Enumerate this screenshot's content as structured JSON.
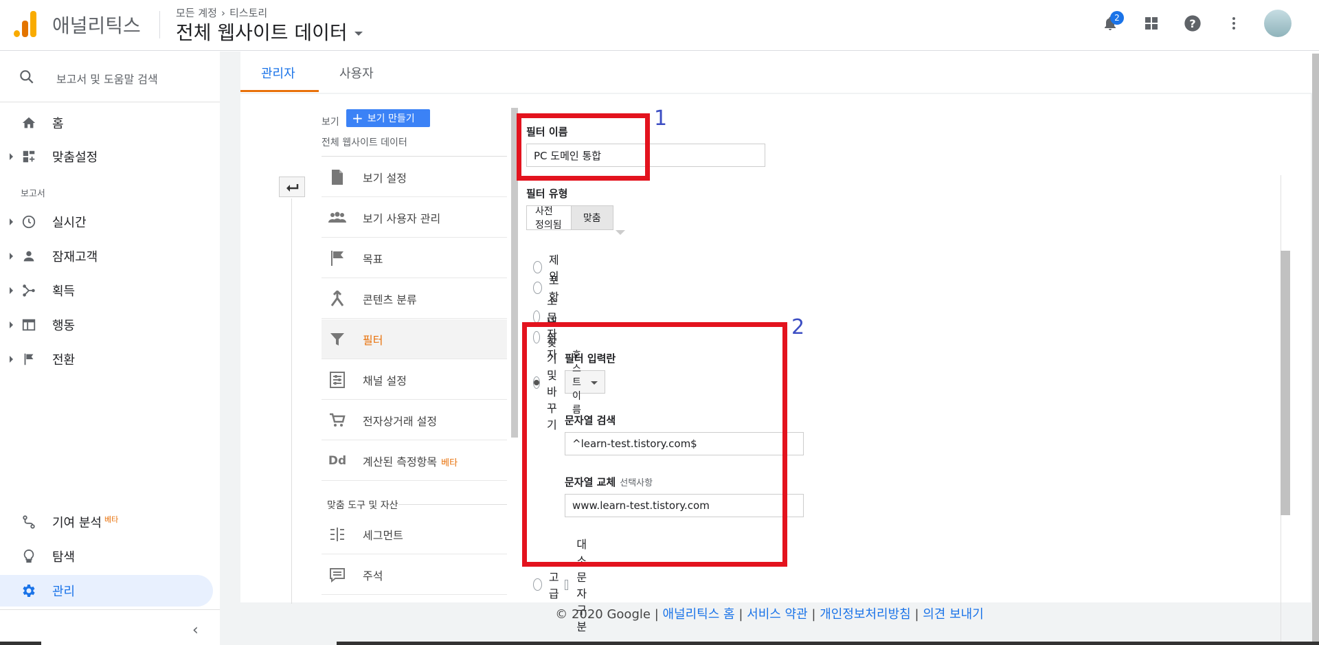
{
  "header": {
    "brand": "애널리틱스",
    "crumb_account": "모든 계정",
    "crumb_sep": "›",
    "crumb_property": "티스토리",
    "property_title": "전체 웹사이트 데이터",
    "notification_count": "2"
  },
  "sidebar": {
    "search_placeholder": "보고서 및 도움말 검색",
    "home": "홈",
    "custom": "맞춤설정",
    "reports_section": "보고서",
    "items": [
      "실시간",
      "잠재고객",
      "획득",
      "행동",
      "전환"
    ],
    "attribution": "기여 분석",
    "attribution_badge": "베타",
    "discover": "탐색",
    "admin": "관리"
  },
  "tabs": [
    "관리자",
    "사용자"
  ],
  "view_column": {
    "view_label": "보기",
    "create_view": "보기 만들기",
    "view_name": "전체 웹사이트 데이터",
    "menu": [
      {
        "label": "보기 설정",
        "icon": "document-icon"
      },
      {
        "label": "보기 사용자 관리",
        "icon": "people-icon"
      },
      {
        "label": "목표",
        "icon": "flag-icon"
      },
      {
        "label": "콘텐츠 분류",
        "icon": "grouping-icon"
      },
      {
        "label": "필터",
        "icon": "filter-icon"
      },
      {
        "label": "채널 설정",
        "icon": "channel-icon"
      },
      {
        "label": "전자상거래 설정",
        "icon": "cart-icon"
      },
      {
        "label": "계산된 측정항목",
        "icon": "dd-icon"
      }
    ],
    "metrics_beta": "베타",
    "personal_tools": "맞춤 도구 및 자산",
    "personal_menu": [
      {
        "label": "세그먼트",
        "icon": "segment-icon"
      },
      {
        "label": "주석",
        "icon": "annotation-icon"
      }
    ],
    "dd_glyph": "Dd"
  },
  "form": {
    "filter_name_label": "필터 이름",
    "filter_name_value": "PC 도메인 통합",
    "filter_type_label": "필터 유형",
    "type_predefined": "사전 정의됨",
    "type_custom": "맞춤",
    "options": [
      "제외",
      "포함",
      "소문자",
      "대문자",
      "찾기 및 바꾸기"
    ],
    "filter_field_label": "필터 입력란",
    "filter_field_value": "호스트 이름",
    "search_string_label": "문자열 검색",
    "search_string_value": "^learn-test.tistory.com$",
    "replace_string_label": "문자열 교체",
    "replace_optional": "선택사항",
    "replace_string_value": "www.learn-test.tistory.com",
    "case_sensitive": "대소문자 구분",
    "advanced": "고급",
    "annotation_1": "1",
    "annotation_2": "2"
  },
  "footer": {
    "copyright": "© 2020 Google",
    "sep": "|",
    "links": [
      "애널리틱스 홈",
      "서비스 약관",
      "개인정보처리방침",
      "의견 보내기"
    ]
  },
  "colors": {
    "accent": "#1a73e8",
    "orange": "#e8710a",
    "highlight_red": "#e3131e",
    "annotation_blue": "#3c4ec3"
  }
}
